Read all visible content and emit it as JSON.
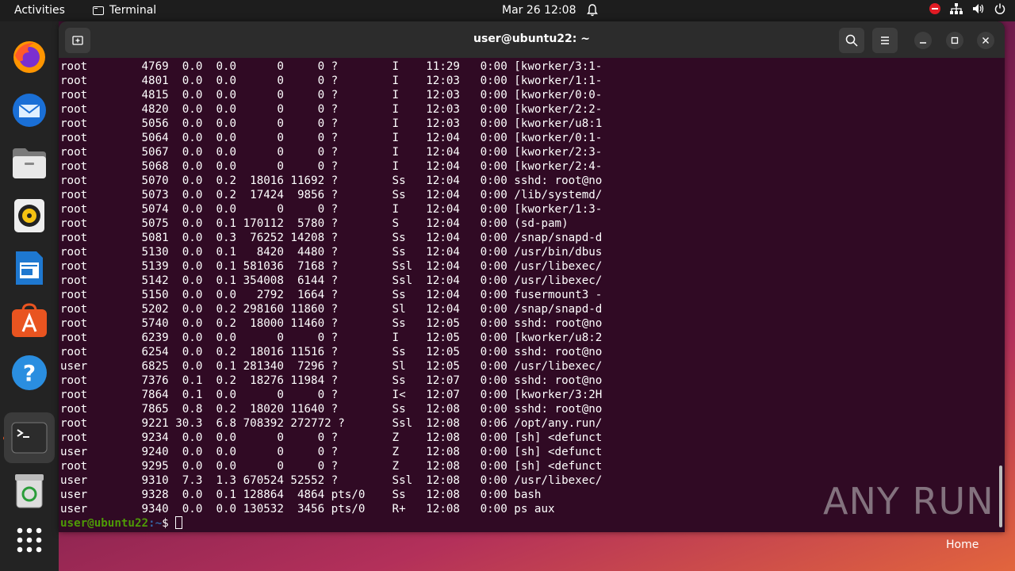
{
  "topbar": {
    "activities": "Activities",
    "app_name": "Terminal",
    "clock": "Mar 26  12:08"
  },
  "dock": {
    "items": [
      "firefox-icon",
      "thunderbird-icon",
      "files-icon",
      "rhythmbox-icon",
      "writer-icon",
      "app-center-icon",
      "help-icon",
      "terminal-icon",
      "trash-icon",
      "show-apps-icon"
    ]
  },
  "window": {
    "title": "user@ubuntu22: ~"
  },
  "terminal": {
    "lines": [
      "root        4769  0.0  0.0      0     0 ?        I    11:29   0:00 [kworker/3:1-",
      "root        4801  0.0  0.0      0     0 ?        I    12:03   0:00 [kworker/1:1-",
      "root        4815  0.0  0.0      0     0 ?        I    12:03   0:00 [kworker/0:0-",
      "root        4820  0.0  0.0      0     0 ?        I    12:03   0:00 [kworker/2:2-",
      "root        5056  0.0  0.0      0     0 ?        I    12:03   0:00 [kworker/u8:1",
      "root        5064  0.0  0.0      0     0 ?        I    12:04   0:00 [kworker/0:1-",
      "root        5067  0.0  0.0      0     0 ?        I    12:04   0:00 [kworker/2:3-",
      "root        5068  0.0  0.0      0     0 ?        I    12:04   0:00 [kworker/2:4-",
      "root        5070  0.0  0.2  18016 11692 ?        Ss   12:04   0:00 sshd: root@no",
      "root        5073  0.0  0.2  17424  9856 ?        Ss   12:04   0:00 /lib/systemd/",
      "root        5074  0.0  0.0      0     0 ?        I    12:04   0:00 [kworker/1:3-",
      "root        5075  0.0  0.1 170112  5780 ?        S    12:04   0:00 (sd-pam)",
      "root        5081  0.0  0.3  76252 14208 ?        Ss   12:04   0:00 /snap/snapd-d",
      "root        5130  0.0  0.1   8420  4480 ?        Ss   12:04   0:00 /usr/bin/dbus",
      "root        5139  0.0  0.1 581036  7168 ?        Ssl  12:04   0:00 /usr/libexec/",
      "root        5142  0.0  0.1 354008  6144 ?        Ssl  12:04   0:00 /usr/libexec/",
      "root        5150  0.0  0.0   2792  1664 ?        Ss   12:04   0:00 fusermount3 -",
      "root        5202  0.0  0.2 298160 11860 ?        Sl   12:04   0:00 /snap/snapd-d",
      "root        5740  0.0  0.2  18000 11460 ?        Ss   12:05   0:00 sshd: root@no",
      "root        6239  0.0  0.0      0     0 ?        I    12:05   0:00 [kworker/u8:2",
      "root        6254  0.0  0.2  18016 11516 ?        Ss   12:05   0:00 sshd: root@no",
      "user        6825  0.0  0.1 281340  7296 ?        Sl   12:05   0:00 /usr/libexec/",
      "root        7376  0.1  0.2  18276 11984 ?        Ss   12:07   0:00 sshd: root@no",
      "root        7864  0.1  0.0      0     0 ?        I<   12:07   0:00 [kworker/3:2H",
      "root        7865  0.8  0.2  18020 11640 ?        Ss   12:08   0:00 sshd: root@no",
      "root        9221 30.3  6.8 708392 272772 ?       Ssl  12:08   0:06 /opt/any.run/",
      "root        9234  0.0  0.0      0     0 ?        Z    12:08   0:00 [sh] <defunct",
      "user        9240  0.0  0.0      0     0 ?        Z    12:08   0:00 [sh] <defunct",
      "root        9295  0.0  0.0      0     0 ?        Z    12:08   0:00 [sh] <defunct",
      "user        9310  7.3  1.3 670524 52552 ?        Ssl  12:08   0:00 /usr/libexec/",
      "user        9328  0.0  0.1 128864  4864 pts/0    Ss   12:08   0:00 bash",
      "user        9340  0.0  0.0 130532  3456 pts/0    R+   12:08   0:00 ps aux"
    ],
    "prompt_user": "user@ubuntu22",
    "prompt_path": ":~",
    "prompt_symbol": "$ "
  },
  "watermark": "ANY RUN",
  "desktop": {
    "home_label": "Home"
  }
}
